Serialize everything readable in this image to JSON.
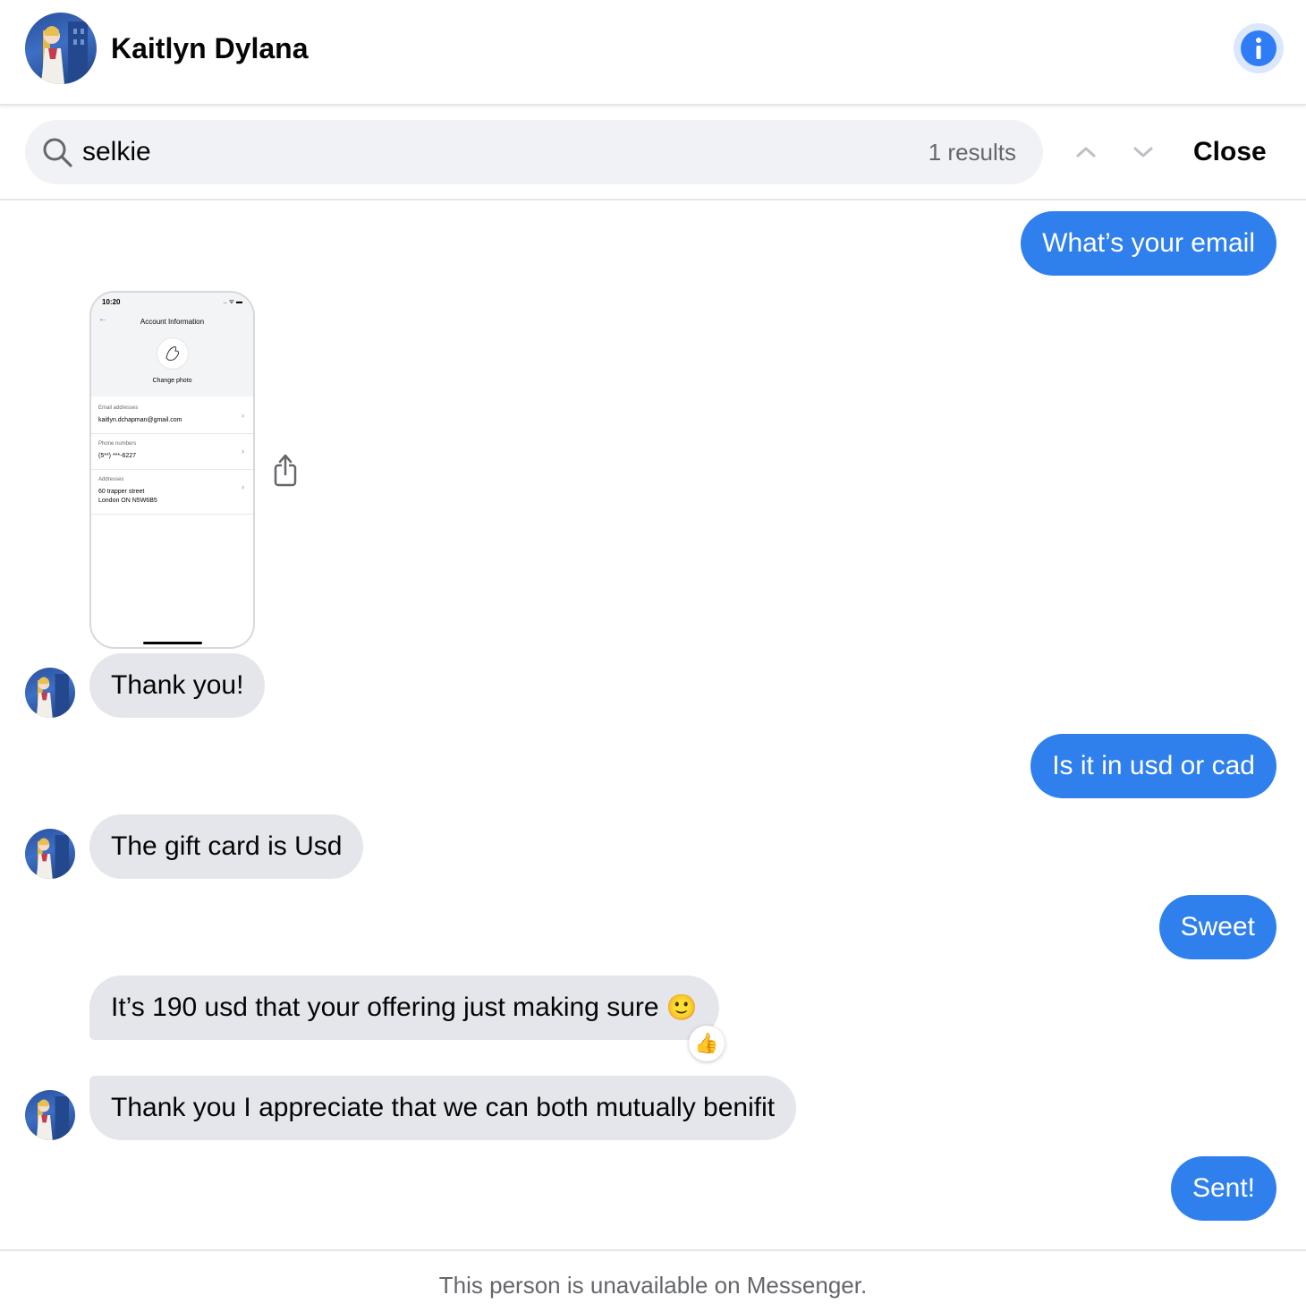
{
  "header": {
    "contact_name": "Kaitlyn Dylana",
    "avatar_icon": "profile-avatar",
    "info_icon": "info-icon"
  },
  "search": {
    "value": "selkie",
    "result_count": "1 results",
    "close_label": "Close"
  },
  "attachment": {
    "status_time": "10:20",
    "status_icons": "..  ᯤ ▬",
    "screen_title": "Account Information",
    "change_photo": "Change photo",
    "rows": [
      {
        "label": "Email addresses",
        "value": "kaitlyn.dchapman@gmail.com"
      },
      {
        "label": "Phone numbers",
        "value": "(5**) ***-6227"
      },
      {
        "label": "Addresses",
        "value": "60 trapper street\nLondon ON N5W6B5"
      }
    ]
  },
  "messages": [
    {
      "sender": "me",
      "text": "What’s your email"
    },
    {
      "sender": "them",
      "text": "Thank you!"
    },
    {
      "sender": "me",
      "text": "Is it in usd or cad"
    },
    {
      "sender": "them",
      "text": "The gift card is Usd"
    },
    {
      "sender": "me",
      "text": "Sweet"
    },
    {
      "sender": "them",
      "text": "It’s 190 usd that your offering just making sure",
      "emoji": "🙂",
      "reaction": "👍"
    },
    {
      "sender": "them",
      "text": "Thank you I appreciate that we can both mutually benifit"
    },
    {
      "sender": "me",
      "text": "Sent!"
    }
  ],
  "footer": {
    "notice": "This person is unavailable on Messenger."
  },
  "colors": {
    "accent": "#2f80ed",
    "incoming_bubble": "#e4e6eb",
    "search_bg": "#f0f2f5"
  }
}
